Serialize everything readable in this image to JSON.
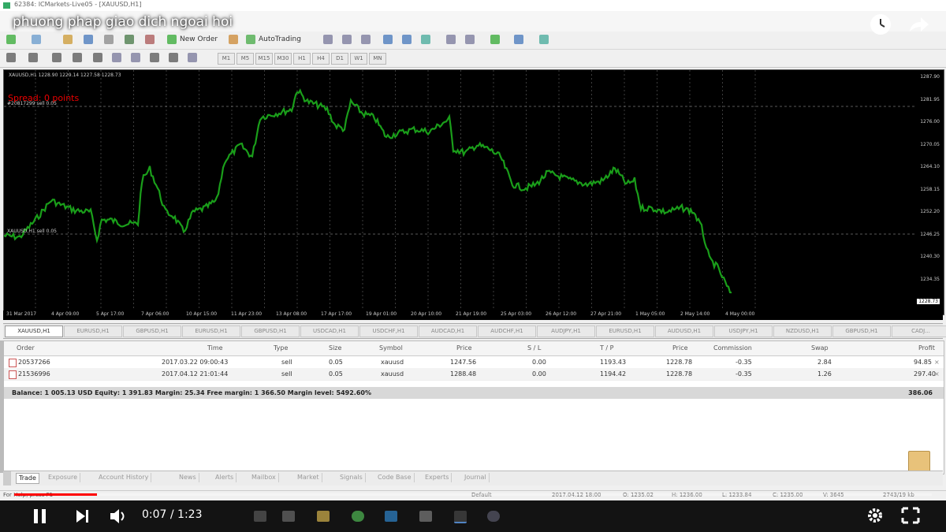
{
  "window": {
    "title": "62384: ICMarkets-Live05 - [XAUUSD,H1]"
  },
  "video": {
    "title": "phuong phap giao dich ngoai hoi",
    "time": "0:07 / 1:23",
    "progress": 0.09
  },
  "toolbar": {
    "new_order": "New Order",
    "autotrading": "AutoTrading"
  },
  "timeframes": [
    "M1",
    "M5",
    "M15",
    "M30",
    "H1",
    "H4",
    "D1",
    "W1",
    "MN"
  ],
  "chart": {
    "info": "XAUUSD,H1  1228.90 1229.14 1227.58 1228.73",
    "spread": "Spread: 0 points",
    "left_level": "XAUUSD,H1 sell 0.05",
    "top_level": "#20817299 sell 0.05",
    "price_labels": [
      "1287.90",
      "1281.95",
      "1276.00",
      "1270.05",
      "1264.10",
      "1258.15",
      "1252.20",
      "1246.25",
      "1240.30",
      "1234.35",
      "1228.73"
    ],
    "date_labels": [
      "31 Mar 2017",
      "4 Apr 09:00",
      "5 Apr 17:00",
      "7 Apr 06:00",
      "10 Apr 15:00",
      "11 Apr 23:00",
      "13 Apr 08:00",
      "17 Apr 17:00",
      "19 Apr 01:00",
      "20 Apr 10:00",
      "21 Apr 19:00",
      "25 Apr 03:00",
      "26 Apr 12:00",
      "27 Apr 21:00",
      "1 May 05:00",
      "2 May 14:00",
      "4 May 00:00"
    ]
  },
  "symbol_tabs": [
    "XAUUSD,H1",
    "EURUSD,H1",
    "GBPUSD,H1",
    "EURUSD,H1",
    "GBPUSD,H1",
    "USDCAD,H1",
    "USDCHF,H1",
    "AUDCAD,H1",
    "AUDCHF,H1",
    "AUDJPY,H1",
    "EURUSD,H1",
    "AUDUSD,H1",
    "USDJPY,H1",
    "NZDUSD,H1",
    "GBPUSD,H1",
    "CADJ..."
  ],
  "terminal": {
    "headers": [
      "Order",
      "Time",
      "Type",
      "Size",
      "Symbol",
      "Price",
      "S / L",
      "T / P",
      "Price",
      "Commission",
      "Swap",
      "Profit"
    ],
    "rows": [
      [
        "20537266",
        "2017.03.22 09:00:43",
        "sell",
        "0.05",
        "xauusd",
        "1247.56",
        "0.00",
        "1193.43",
        "1228.78",
        "-0.35",
        "2.84",
        "94.85"
      ],
      [
        "21536996",
        "2017.04.12 21:01:44",
        "sell",
        "0.05",
        "xauusd",
        "1288.48",
        "0.00",
        "1194.42",
        "1228.78",
        "-0.35",
        "1.26",
        "297.40"
      ]
    ],
    "balance": "Balance: 1 005.13 USD  Equity: 1 391.83  Margin: 25.34  Free margin: 1 366.50  Margin level: 5492.60%",
    "total_profit": "386.06"
  },
  "bottom_tabs": [
    "Trade",
    "Exposure",
    "Account History",
    "News",
    "Alerts",
    "Mailbox",
    "Market",
    "Signals",
    "Code Base",
    "Experts",
    "Journal"
  ],
  "status": {
    "help": "For Help, press F1",
    "profile": "Default",
    "datetime": "2017.04.12 18:00",
    "open": "O: 1235.02",
    "high": "H: 1236.00",
    "low": "L: 1233.84",
    "close": "C: 1235.00",
    "volume": "V: 3645",
    "traffic": "2743/19 kb"
  },
  "colors": {
    "candle": "#1a9e1a",
    "spread": "#e00000",
    "progress": "#ff0000"
  }
}
